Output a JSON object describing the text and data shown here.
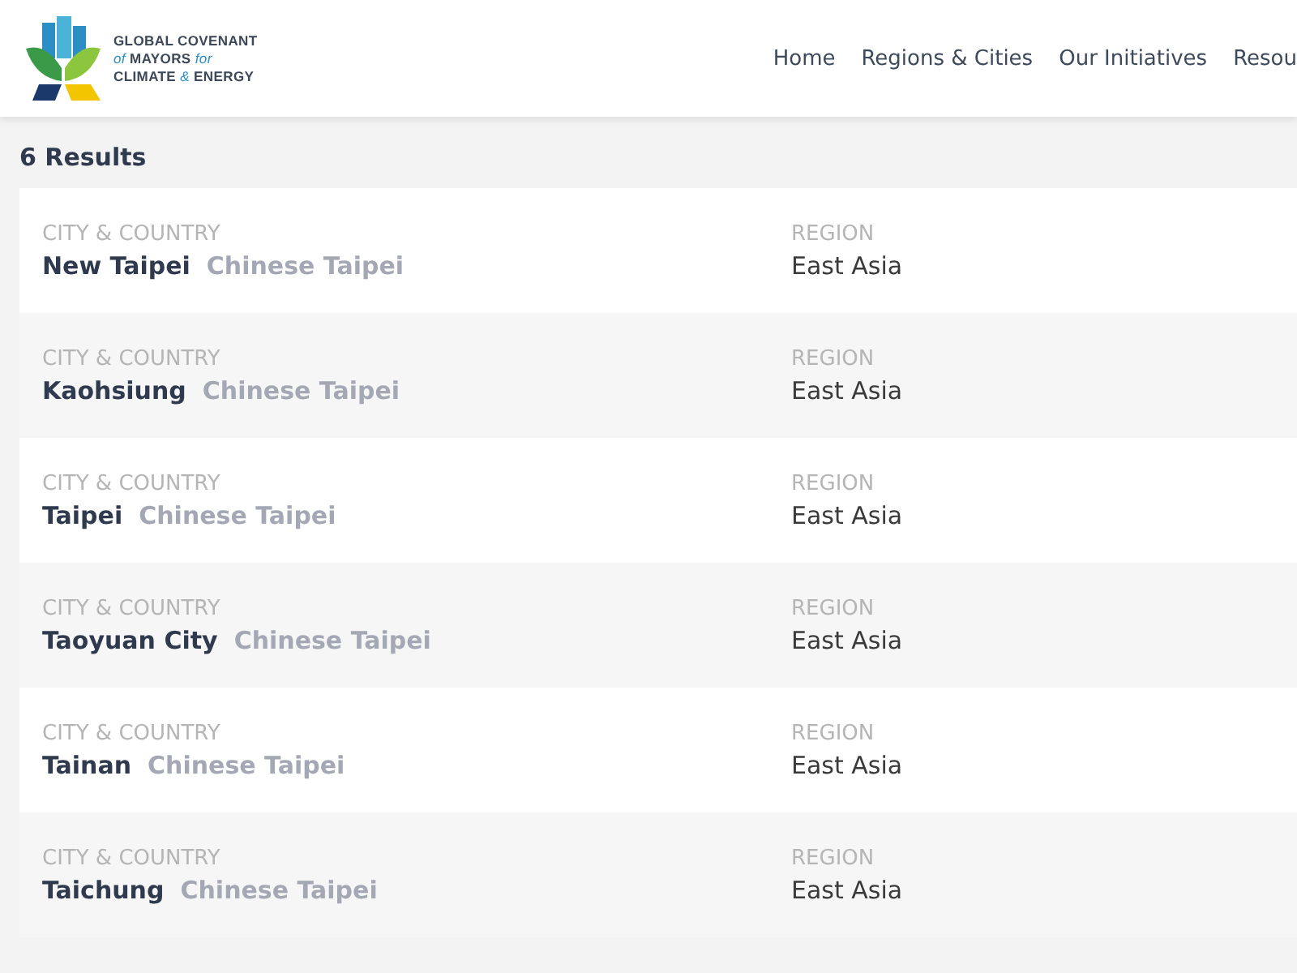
{
  "logo": {
    "lines": [
      [
        {
          "text": "GLOBAL COVENANT",
          "accent": false
        }
      ],
      [
        {
          "text": "of",
          "accent": true
        },
        {
          "text": " MAYORS ",
          "accent": false
        },
        {
          "text": "for",
          "accent": true
        }
      ],
      [
        {
          "text": "CLIMATE ",
          "accent": false
        },
        {
          "text": "&",
          "accent": true
        },
        {
          "text": " ENERGY",
          "accent": false
        }
      ]
    ]
  },
  "nav": [
    "Home",
    "Regions & Cities",
    "Our Initiatives",
    "Resou"
  ],
  "results_count": "6 Results",
  "results": [
    {
      "city_label": "CITY & COUNTRY",
      "city": "New Taipei",
      "country": "Chinese Taipei",
      "region_label": "REGION",
      "region": "East Asia"
    },
    {
      "city_label": "CITY & COUNTRY",
      "city": "Kaohsiung",
      "country": "Chinese Taipei",
      "region_label": "REGION",
      "region": "East Asia"
    },
    {
      "city_label": "CITY & COUNTRY",
      "city": "Taipei",
      "country": "Chinese Taipei",
      "region_label": "REGION",
      "region": "East Asia"
    },
    {
      "city_label": "CITY & COUNTRY",
      "city": "Taoyuan City",
      "country": "Chinese Taipei",
      "region_label": "REGION",
      "region": "East Asia"
    },
    {
      "city_label": "CITY & COUNTRY",
      "city": "Tainan",
      "country": "Chinese Taipei",
      "region_label": "REGION",
      "region": "East Asia"
    },
    {
      "city_label": "CITY & COUNTRY",
      "city": "Taichung",
      "country": "Chinese Taipei",
      "region_label": "REGION",
      "region": "East Asia"
    }
  ]
}
